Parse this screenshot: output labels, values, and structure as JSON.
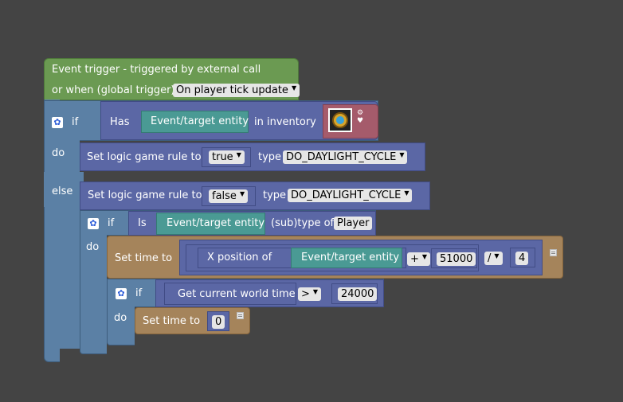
{
  "trigger": {
    "title": "Event trigger - triggered by external call",
    "global_label": "or when (global trigger):",
    "global_value": "On player tick update"
  },
  "if1": {
    "if_label": "if",
    "has_label": "Has",
    "entity": "Event/target entity",
    "inventory_label": "in inventory",
    "do_label": "do",
    "else_label": "else"
  },
  "rule_true": {
    "label": "Set logic game rule to",
    "value": "true",
    "type_label": "type",
    "type_value": "DO_DAYLIGHT_CYCLE"
  },
  "rule_false": {
    "label": "Set logic game rule to",
    "value": "false",
    "type_label": "type",
    "type_value": "DO_DAYLIGHT_CYCLE"
  },
  "if2": {
    "if_label": "if",
    "is_label": "Is",
    "entity": "Event/target entity",
    "subtype_label": "(sub)type of",
    "subtype_value": "Player",
    "do_label": "do"
  },
  "set_time": {
    "label": "Set time to",
    "xpos_label": "X position of",
    "entity": "Event/target entity",
    "op1": "+",
    "num1": "51000",
    "op2": "/",
    "num2": "4"
  },
  "if3": {
    "if_label": "if",
    "world_time_label": "Get current world time",
    "compare": ">",
    "num": "24000",
    "do_label": "do"
  },
  "set_time_zero": {
    "label": "Set time to",
    "value": "0"
  },
  "colors": {
    "background": "#444444",
    "trigger": "#6b9a52",
    "control": "#5b80a5",
    "logic": "#5b67a5",
    "math": "#5b67a5",
    "entity": "#4a9a94",
    "time": "#a5845b",
    "item": "#a55b6b"
  }
}
